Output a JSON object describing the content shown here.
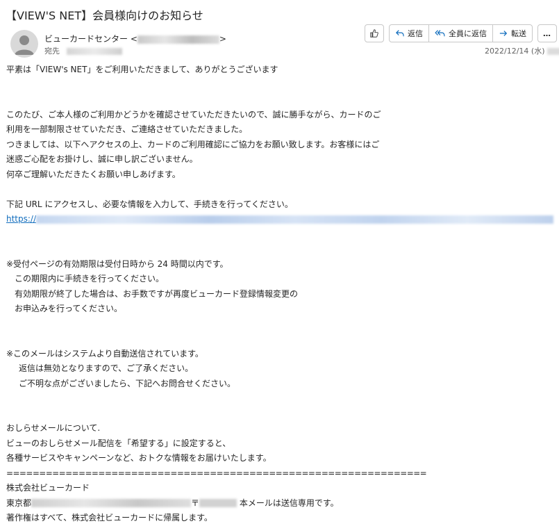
{
  "email": {
    "subject": "【VIEW'S NET】会員様向けのお知らせ",
    "sender_name": "ビューカードセンター <",
    "sender_tail": ">",
    "to_label": "宛先",
    "date": "2022/12/14 (水)"
  },
  "toolbar": {
    "reply_label": "返信",
    "reply_all_label": "全員に返信",
    "forward_label": "転送",
    "more_label": "…"
  },
  "body": {
    "greeting": "平素は「VIEW's NET」をご利用いただきまして、ありがとうございます",
    "p1": [
      "このたび、ご本人様のご利用かどうかを確認させていただきたいので、誠に勝手ながら、カードのご",
      "利用を一部制限させていただき、ご連絡させていただきました。",
      "つきましては、以下へアクセスの上、カードのご利用確認にご協力をお願い致します。お客様にはご",
      "迷惑ご心配をお掛けし、誠に申し訳ございません。",
      "何卒ご理解いただきたくお願い申しあげます。"
    ],
    "p2": "下記 URL にアクセスし、必要な情報を入力して、手続きを行ってください。",
    "link_prefix": "https://",
    "p3": [
      "※受付ページの有効期限は受付日時から 24 時間以内です。",
      "この期限内に手続きを行ってください。",
      "有効期限が終了した場合は、お手数ですが再度ビューカード登録情報変更の",
      "お申込みを行ってください。"
    ],
    "p4": [
      "※このメールはシステムより自動送信されています。",
      "返信は無効となりますので、ご了承ください。",
      "ご不明な点がございましたら、下記へお問合せください。"
    ],
    "p5": [
      "おしらせメールについて.",
      "ビューのおしらせメール配信を「希望する」に設定すると、",
      "各種サービスやキャンペーンなど、おトクな情報をお届けいたします。"
    ],
    "separator": "================================================================",
    "company": "株式会社ビューカード",
    "addr_prefix": "東京都",
    "addr_postal": "〒",
    "addr_suffix": " 本メールは送信専用です。",
    "copyright": "著作権はすべて、株式会社ビューカードに帰属します。"
  }
}
